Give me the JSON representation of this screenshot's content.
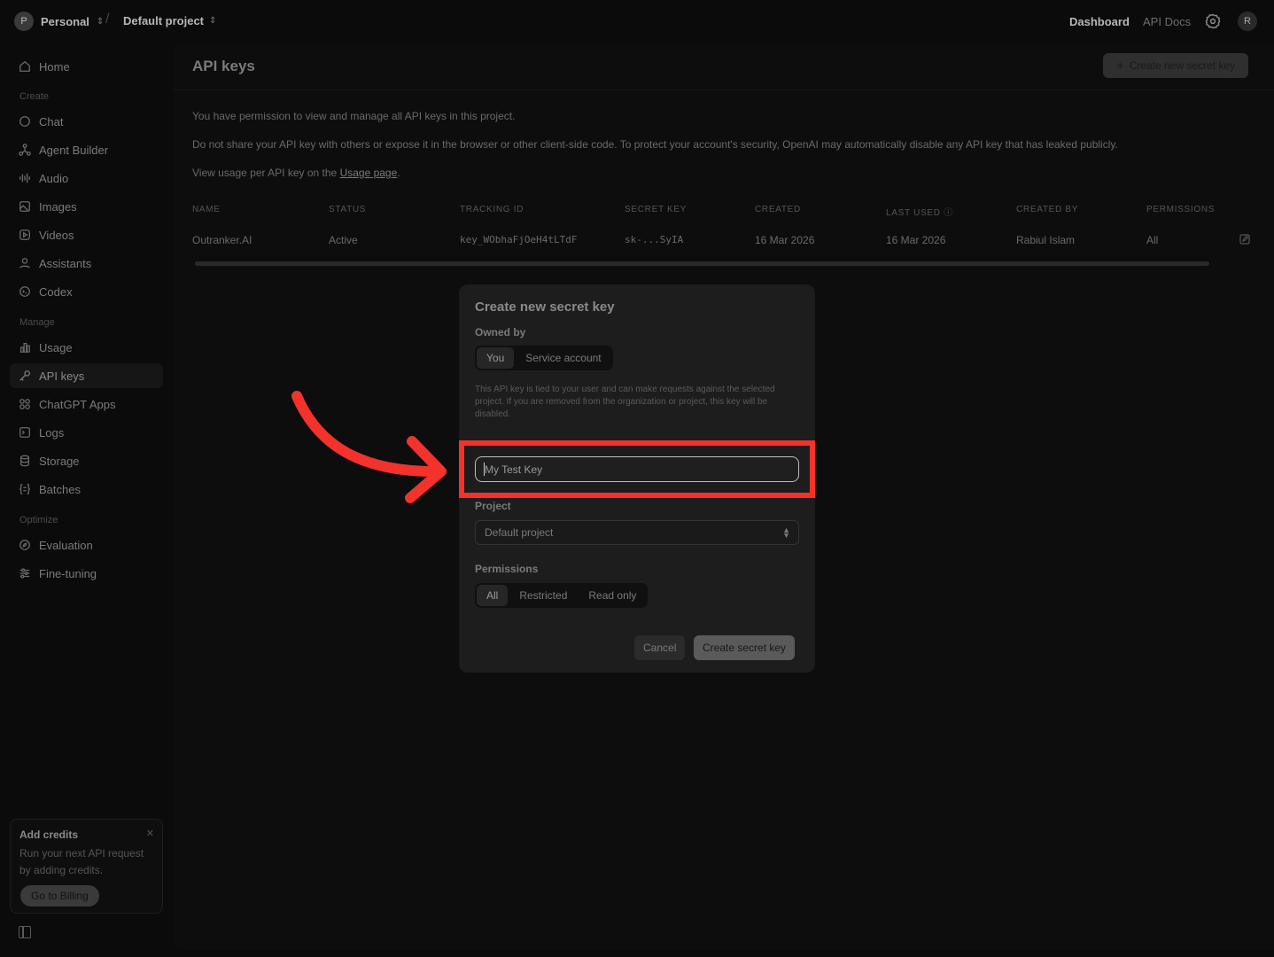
{
  "topbar": {
    "org_initial": "P",
    "org_name": "Personal",
    "project_name": "Default project",
    "nav_dashboard": "Dashboard",
    "nav_docs": "API Docs",
    "user_initial": "R"
  },
  "sidebar": {
    "home": "Home",
    "section_create": "Create",
    "chat": "Chat",
    "agent_builder": "Agent Builder",
    "audio": "Audio",
    "images": "Images",
    "videos": "Videos",
    "assistants": "Assistants",
    "codex": "Codex",
    "section_manage": "Manage",
    "usage": "Usage",
    "api_keys": "API keys",
    "chatgpt_apps": "ChatGPT Apps",
    "logs": "Logs",
    "storage": "Storage",
    "batches": "Batches",
    "section_optimize": "Optimize",
    "evaluation": "Evaluation",
    "fine_tuning": "Fine-tuning",
    "credits": {
      "title": "Add credits",
      "text": "Run your next API request by adding credits.",
      "button": "Go to Billing"
    }
  },
  "main": {
    "title": "API keys",
    "create_button": "Create new secret key",
    "p1": "You have permission to view and manage all API keys in this project.",
    "p2": "Do not share your API key with others or expose it in the browser or other client-side code. To protect your account's security, OpenAI may automatically disable any API key that has leaked publicly.",
    "p3_prefix": "View usage per API key on the ",
    "p3_link": "Usage page",
    "p3_suffix": ".",
    "table": {
      "headers": [
        "NAME",
        "STATUS",
        "TRACKING ID",
        "SECRET KEY",
        "CREATED",
        "LAST USED",
        "CREATED BY",
        "PERMISSIONS"
      ],
      "row": [
        "Outranker.AI",
        "Active",
        "key_WObhaFjOeH4tLTdF",
        "sk-...SyIA",
        "16 Mar 2026",
        "16 Mar 2026",
        "Rabiul Islam",
        "All"
      ]
    }
  },
  "modal": {
    "title": "Create new secret key",
    "owned_by_label": "Owned by",
    "owned_options": [
      "You",
      "Service account"
    ],
    "description": "This API key is tied to your user and can make requests against the selected project. If you are removed from the organization or project, this key will be disabled.",
    "name_value": "My Test Key",
    "project_label": "Project",
    "project_value": "Default project",
    "permissions_label": "Permissions",
    "permission_options": [
      "All",
      "Restricted",
      "Read only"
    ],
    "cancel": "Cancel",
    "create": "Create secret key"
  },
  "colors": {
    "highlight": "#f2322b",
    "background": "#0b0b0b"
  }
}
